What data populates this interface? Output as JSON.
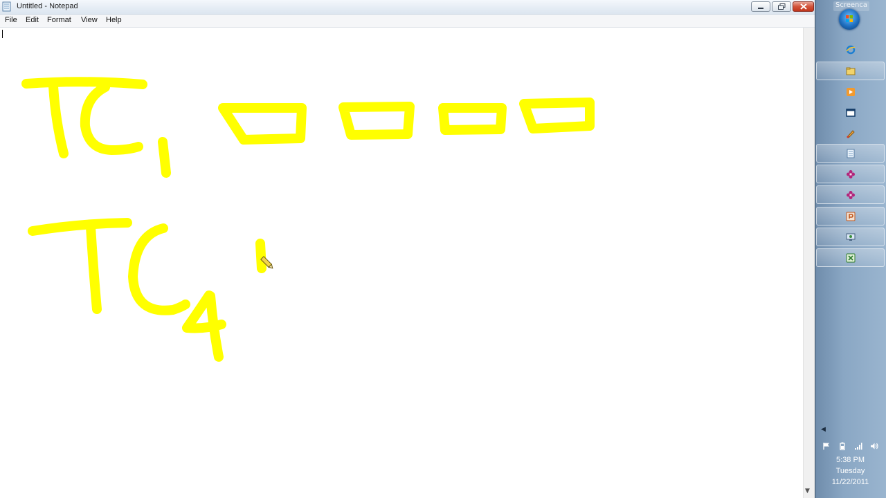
{
  "window": {
    "title": "Untitled - Notepad",
    "controls": {
      "minimize": "minimize",
      "maximize": "restore",
      "close": "close"
    }
  },
  "menu": {
    "items": [
      "File",
      "Edit",
      "Format",
      "View",
      "Help"
    ]
  },
  "editor": {
    "text": "",
    "ink_color": "#ffff00"
  },
  "taskbar": {
    "screencast_label": "Screenca",
    "buttons": [
      "internet-explorer-icon",
      "file-explorer-icon",
      "media-player-icon",
      "window-icon",
      "paint-icon",
      "notepad-icon",
      "flower-app-icon",
      "flower-app-icon",
      "powerpoint-icon",
      "remote-desktop-icon",
      "excel-icon"
    ],
    "tray_icons": [
      "flag-icon",
      "power-icon",
      "signal-icon",
      "volume-icon"
    ],
    "clock": {
      "time": "5:38 PM",
      "day": "Tuesday",
      "date": "11/22/2011"
    }
  }
}
